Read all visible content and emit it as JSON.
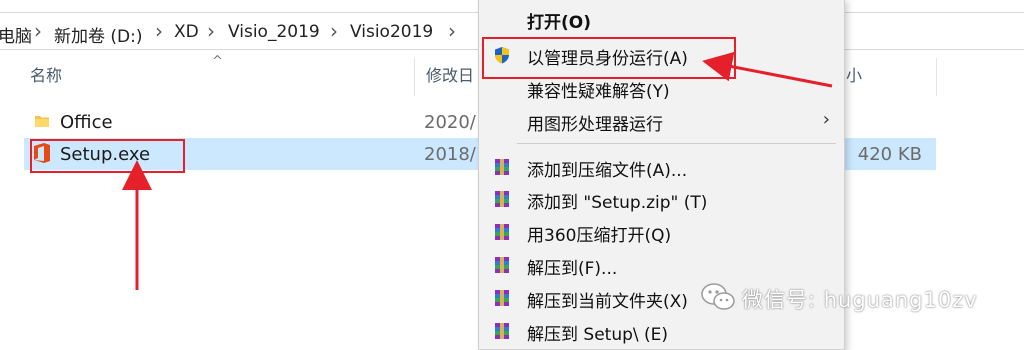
{
  "breadcrumb": {
    "items": [
      "电脑",
      "新加卷 (D:)",
      "XD",
      "Visio_2019",
      "Visio2019"
    ]
  },
  "columns": {
    "name": "名称",
    "modified": "修改日",
    "size": "小"
  },
  "files": [
    {
      "name": "Office",
      "date": "2020/",
      "size": "",
      "icon": "folder-icon"
    },
    {
      "name": "Setup.exe",
      "date": "2018/",
      "size": "420 KB",
      "icon": "office-icon",
      "selected": true
    }
  ],
  "context_menu": {
    "open": "打开(O)",
    "run_as_admin": "以管理员身份运行(A)",
    "compat": "兼容性疑难解答(Y)",
    "gpu": "用图形处理器运行",
    "add_archive": "添加到压缩文件(A)...",
    "add_zip": "添加到 \"Setup.zip\" (T)",
    "open_360": "用360压缩打开(Q)",
    "extract_to": "解压到(F)...",
    "extract_here": "解压到当前文件夹(X)",
    "extract_setup": "解压到 Setup\\ (E)"
  },
  "watermark": {
    "text": "微信号: huguang10zv"
  },
  "colors": {
    "selection": "#cce8ff",
    "highlight": "#e5202a",
    "menu_bg": "#f2f2f2"
  }
}
